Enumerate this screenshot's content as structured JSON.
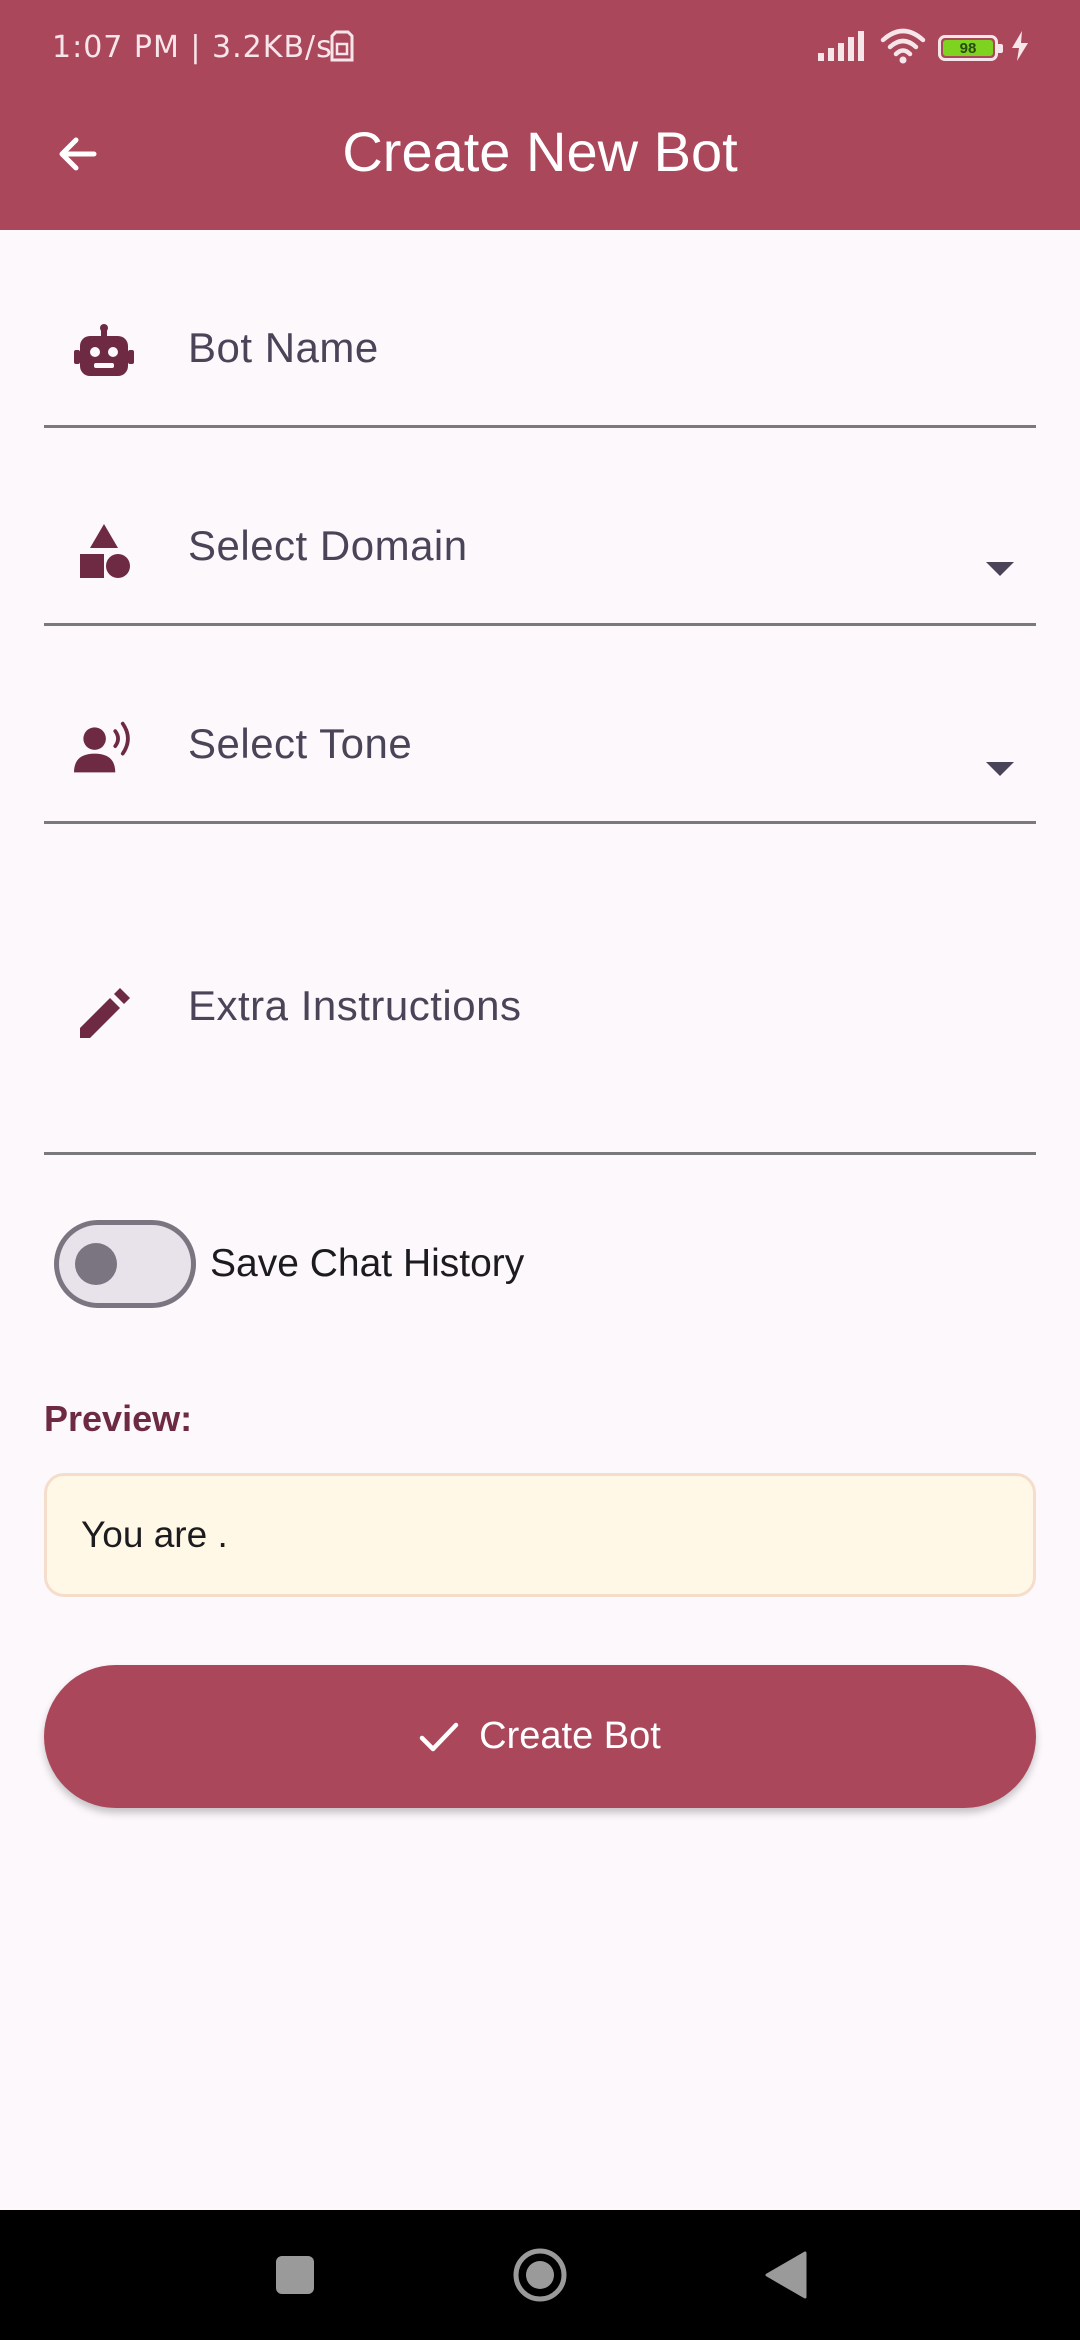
{
  "status_bar": {
    "time_speed": "1:07 PM | 3.2KB/s",
    "battery_level": "98"
  },
  "app_bar": {
    "title": "Create New Bot",
    "back_icon": "arrow-left-icon"
  },
  "form": {
    "bot_name": {
      "placeholder": "Bot Name",
      "icon": "robot-icon"
    },
    "domain": {
      "placeholder": "Select Domain",
      "icon": "shapes-icon"
    },
    "tone": {
      "placeholder": "Select Tone",
      "icon": "voice-icon"
    },
    "extra_instructions": {
      "placeholder": "Extra Instructions",
      "icon": "pencil-icon"
    }
  },
  "save_history": {
    "label": "Save Chat History",
    "enabled": false
  },
  "preview": {
    "label": "Preview:",
    "text": "You are ."
  },
  "create_button": {
    "label": "Create Bot",
    "icon": "check-icon"
  },
  "colors": {
    "primary": "#AB475B",
    "preview_background": "#FFF8E7",
    "page_background": "#FCF8FC",
    "icon": "#6E2A42"
  }
}
